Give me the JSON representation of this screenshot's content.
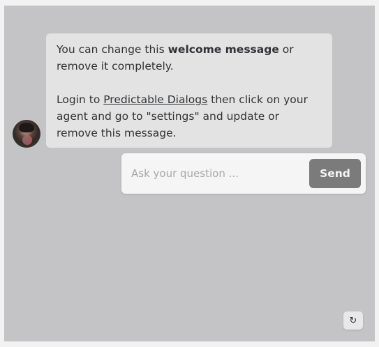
{
  "chat": {
    "welcome": {
      "line1_pre": "You can change this ",
      "line1_bold": "welcome message",
      "line1_post": " or remove it completely.",
      "line2_pre": "Login to ",
      "line2_link": "Predictable Dialogs",
      "line2_post": " then click on your agent and go to \"settings\" and update or remove this message."
    },
    "input": {
      "placeholder": "Ask your question ...",
      "value": ""
    },
    "send_label": "Send",
    "restart_icon": "restart-icon",
    "avatar_icon": "bot-avatar"
  },
  "colors": {
    "panel_bg": "#c4c4c6",
    "bubble_bg": "#e3e3e3",
    "send_bg": "#7b7b7b",
    "text": "#303235"
  }
}
